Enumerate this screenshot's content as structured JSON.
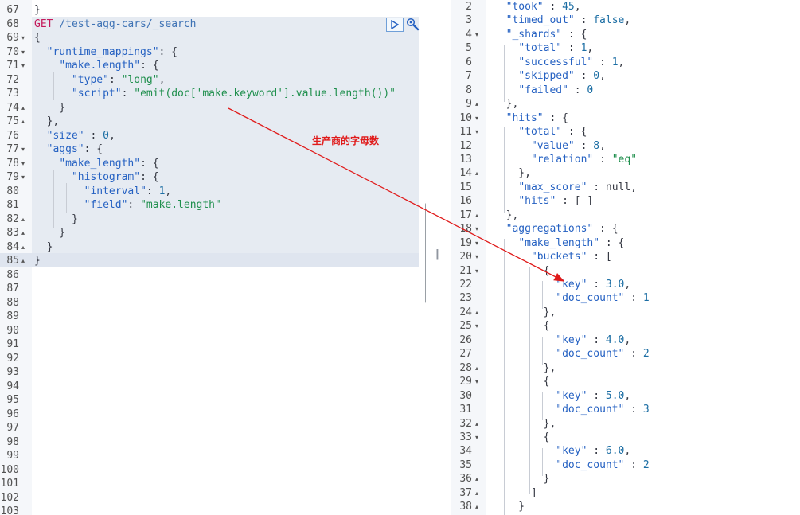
{
  "request_editor": {
    "lines": [
      {
        "n": "67",
        "fold": "",
        "parts": [
          [
            "p",
            "}"
          ]
        ]
      },
      {
        "n": "68",
        "fold": "",
        "parts": [
          [
            "m",
            "GET"
          ],
          [
            "p",
            " "
          ],
          [
            "u",
            "/test-agg-cars/_search"
          ]
        ]
      },
      {
        "n": "69",
        "fold": "▾",
        "parts": [
          [
            "p",
            "{"
          ]
        ]
      },
      {
        "n": "70",
        "fold": "▾",
        "parts": [
          [
            "p",
            "  "
          ],
          [
            "k",
            "\"runtime_mappings\""
          ],
          [
            "p",
            ": {"
          ]
        ]
      },
      {
        "n": "71",
        "fold": "▾",
        "parts": [
          [
            "p",
            "    "
          ],
          [
            "k",
            "\"make.length\""
          ],
          [
            "p",
            ": {"
          ]
        ]
      },
      {
        "n": "72",
        "fold": "",
        "parts": [
          [
            "p",
            "      "
          ],
          [
            "k",
            "\"type\""
          ],
          [
            "p",
            ": "
          ],
          [
            "s",
            "\"long\""
          ],
          [
            "p",
            ","
          ]
        ]
      },
      {
        "n": "73",
        "fold": "",
        "parts": [
          [
            "p",
            "      "
          ],
          [
            "k",
            "\"script\""
          ],
          [
            "p",
            ": "
          ],
          [
            "s",
            "\"emit(doc['make.keyword'].value.length())\""
          ]
        ]
      },
      {
        "n": "74",
        "fold": "▴",
        "parts": [
          [
            "p",
            "    }"
          ]
        ]
      },
      {
        "n": "75",
        "fold": "▴",
        "parts": [
          [
            "p",
            "  },"
          ]
        ]
      },
      {
        "n": "76",
        "fold": "",
        "parts": [
          [
            "p",
            "  "
          ],
          [
            "k",
            "\"size\""
          ],
          [
            "p",
            " : "
          ],
          [
            "n",
            "0"
          ],
          [
            "p",
            ","
          ]
        ]
      },
      {
        "n": "77",
        "fold": "▾",
        "parts": [
          [
            "p",
            "  "
          ],
          [
            "k",
            "\"aggs\""
          ],
          [
            "p",
            ": {"
          ]
        ]
      },
      {
        "n": "78",
        "fold": "▾",
        "parts": [
          [
            "p",
            "    "
          ],
          [
            "k",
            "\"make_length\""
          ],
          [
            "p",
            ": {"
          ]
        ]
      },
      {
        "n": "79",
        "fold": "▾",
        "parts": [
          [
            "p",
            "      "
          ],
          [
            "k",
            "\"histogram\""
          ],
          [
            "p",
            ": {"
          ]
        ]
      },
      {
        "n": "80",
        "fold": "",
        "parts": [
          [
            "p",
            "        "
          ],
          [
            "k",
            "\"interval\""
          ],
          [
            "p",
            ": "
          ],
          [
            "n",
            "1"
          ],
          [
            "p",
            ","
          ]
        ]
      },
      {
        "n": "81",
        "fold": "",
        "parts": [
          [
            "p",
            "        "
          ],
          [
            "k",
            "\"field\""
          ],
          [
            "p",
            ": "
          ],
          [
            "s",
            "\"make.length\""
          ]
        ]
      },
      {
        "n": "82",
        "fold": "▴",
        "parts": [
          [
            "p",
            "      }"
          ]
        ]
      },
      {
        "n": "83",
        "fold": "▴",
        "parts": [
          [
            "p",
            "    }"
          ]
        ]
      },
      {
        "n": "84",
        "fold": "▴",
        "parts": [
          [
            "p",
            "  }"
          ]
        ]
      },
      {
        "n": "85",
        "fold": "▴",
        "parts": [
          [
            "p",
            "}"
          ]
        ]
      },
      {
        "n": "86",
        "fold": "",
        "parts": []
      },
      {
        "n": "87",
        "fold": "",
        "parts": []
      },
      {
        "n": "88",
        "fold": "",
        "parts": []
      },
      {
        "n": "89",
        "fold": "",
        "parts": []
      },
      {
        "n": "90",
        "fold": "",
        "parts": []
      },
      {
        "n": "91",
        "fold": "",
        "parts": []
      },
      {
        "n": "92",
        "fold": "",
        "parts": []
      },
      {
        "n": "93",
        "fold": "",
        "parts": []
      },
      {
        "n": "94",
        "fold": "",
        "parts": []
      },
      {
        "n": "95",
        "fold": "",
        "parts": []
      },
      {
        "n": "96",
        "fold": "",
        "parts": []
      },
      {
        "n": "97",
        "fold": "",
        "parts": []
      },
      {
        "n": "98",
        "fold": "",
        "parts": []
      },
      {
        "n": "99",
        "fold": "",
        "parts": []
      },
      {
        "n": "100",
        "fold": "",
        "parts": []
      },
      {
        "n": "101",
        "fold": "",
        "parts": []
      },
      {
        "n": "102",
        "fold": "",
        "parts": []
      },
      {
        "n": "103",
        "fold": "",
        "parts": []
      }
    ]
  },
  "response_viewer": {
    "lines": [
      {
        "n": "2",
        "fold": "",
        "parts": [
          [
            "p",
            "  "
          ],
          [
            "k",
            "\"took\""
          ],
          [
            "p",
            " : "
          ],
          [
            "n",
            "45"
          ],
          [
            "p",
            ","
          ]
        ]
      },
      {
        "n": "3",
        "fold": "",
        "parts": [
          [
            "p",
            "  "
          ],
          [
            "k",
            "\"timed_out\""
          ],
          [
            "p",
            " : "
          ],
          [
            "n",
            "false"
          ],
          [
            "p",
            ","
          ]
        ]
      },
      {
        "n": "4",
        "fold": "▾",
        "parts": [
          [
            "p",
            "  "
          ],
          [
            "k",
            "\"_shards\""
          ],
          [
            "p",
            " : {"
          ]
        ]
      },
      {
        "n": "5",
        "fold": "",
        "parts": [
          [
            "p",
            "    "
          ],
          [
            "k",
            "\"total\""
          ],
          [
            "p",
            " : "
          ],
          [
            "n",
            "1"
          ],
          [
            "p",
            ","
          ]
        ]
      },
      {
        "n": "6",
        "fold": "",
        "parts": [
          [
            "p",
            "    "
          ],
          [
            "k",
            "\"successful\""
          ],
          [
            "p",
            " : "
          ],
          [
            "n",
            "1"
          ],
          [
            "p",
            ","
          ]
        ]
      },
      {
        "n": "7",
        "fold": "",
        "parts": [
          [
            "p",
            "    "
          ],
          [
            "k",
            "\"skipped\""
          ],
          [
            "p",
            " : "
          ],
          [
            "n",
            "0"
          ],
          [
            "p",
            ","
          ]
        ]
      },
      {
        "n": "8",
        "fold": "",
        "parts": [
          [
            "p",
            "    "
          ],
          [
            "k",
            "\"failed\""
          ],
          [
            "p",
            " : "
          ],
          [
            "n",
            "0"
          ]
        ]
      },
      {
        "n": "9",
        "fold": "▴",
        "parts": [
          [
            "p",
            "  },"
          ]
        ]
      },
      {
        "n": "10",
        "fold": "▾",
        "parts": [
          [
            "p",
            "  "
          ],
          [
            "k",
            "\"hits\""
          ],
          [
            "p",
            " : {"
          ]
        ]
      },
      {
        "n": "11",
        "fold": "▾",
        "parts": [
          [
            "p",
            "    "
          ],
          [
            "k",
            "\"total\""
          ],
          [
            "p",
            " : {"
          ]
        ]
      },
      {
        "n": "12",
        "fold": "",
        "parts": [
          [
            "p",
            "      "
          ],
          [
            "k",
            "\"value\""
          ],
          [
            "p",
            " : "
          ],
          [
            "n",
            "8"
          ],
          [
            "p",
            ","
          ]
        ]
      },
      {
        "n": "13",
        "fold": "",
        "parts": [
          [
            "p",
            "      "
          ],
          [
            "k",
            "\"relation\""
          ],
          [
            "p",
            " : "
          ],
          [
            "s",
            "\"eq\""
          ]
        ]
      },
      {
        "n": "14",
        "fold": "▴",
        "parts": [
          [
            "p",
            "    },"
          ]
        ]
      },
      {
        "n": "15",
        "fold": "",
        "parts": [
          [
            "p",
            "    "
          ],
          [
            "k",
            "\"max_score\""
          ],
          [
            "p",
            " : "
          ],
          [
            "p",
            "null"
          ],
          [
            "p",
            ","
          ]
        ]
      },
      {
        "n": "16",
        "fold": "",
        "parts": [
          [
            "p",
            "    "
          ],
          [
            "k",
            "\"hits\""
          ],
          [
            "p",
            " : [ ]"
          ]
        ]
      },
      {
        "n": "17",
        "fold": "▴",
        "parts": [
          [
            "p",
            "  },"
          ]
        ]
      },
      {
        "n": "18",
        "fold": "▾",
        "parts": [
          [
            "p",
            "  "
          ],
          [
            "k",
            "\"aggregations\""
          ],
          [
            "p",
            " : {"
          ]
        ]
      },
      {
        "n": "19",
        "fold": "▾",
        "parts": [
          [
            "p",
            "    "
          ],
          [
            "k",
            "\"make_length\""
          ],
          [
            "p",
            " : {"
          ]
        ]
      },
      {
        "n": "20",
        "fold": "▾",
        "parts": [
          [
            "p",
            "      "
          ],
          [
            "k",
            "\"buckets\""
          ],
          [
            "p",
            " : ["
          ]
        ]
      },
      {
        "n": "21",
        "fold": "▾",
        "parts": [
          [
            "p",
            "        {"
          ]
        ]
      },
      {
        "n": "22",
        "fold": "",
        "parts": [
          [
            "p",
            "          "
          ],
          [
            "k",
            "\"key\""
          ],
          [
            "p",
            " : "
          ],
          [
            "n",
            "3.0"
          ],
          [
            "p",
            ","
          ]
        ]
      },
      {
        "n": "23",
        "fold": "",
        "parts": [
          [
            "p",
            "          "
          ],
          [
            "k",
            "\"doc_count\""
          ],
          [
            "p",
            " : "
          ],
          [
            "n",
            "1"
          ]
        ]
      },
      {
        "n": "24",
        "fold": "▴",
        "parts": [
          [
            "p",
            "        },"
          ]
        ]
      },
      {
        "n": "25",
        "fold": "▾",
        "parts": [
          [
            "p",
            "        {"
          ]
        ]
      },
      {
        "n": "26",
        "fold": "",
        "parts": [
          [
            "p",
            "          "
          ],
          [
            "k",
            "\"key\""
          ],
          [
            "p",
            " : "
          ],
          [
            "n",
            "4.0"
          ],
          [
            "p",
            ","
          ]
        ]
      },
      {
        "n": "27",
        "fold": "",
        "parts": [
          [
            "p",
            "          "
          ],
          [
            "k",
            "\"doc_count\""
          ],
          [
            "p",
            " : "
          ],
          [
            "n",
            "2"
          ]
        ]
      },
      {
        "n": "28",
        "fold": "▴",
        "parts": [
          [
            "p",
            "        },"
          ]
        ]
      },
      {
        "n": "29",
        "fold": "▾",
        "parts": [
          [
            "p",
            "        {"
          ]
        ]
      },
      {
        "n": "30",
        "fold": "",
        "parts": [
          [
            "p",
            "          "
          ],
          [
            "k",
            "\"key\""
          ],
          [
            "p",
            " : "
          ],
          [
            "n",
            "5.0"
          ],
          [
            "p",
            ","
          ]
        ]
      },
      {
        "n": "31",
        "fold": "",
        "parts": [
          [
            "p",
            "          "
          ],
          [
            "k",
            "\"doc_count\""
          ],
          [
            "p",
            " : "
          ],
          [
            "n",
            "3"
          ]
        ]
      },
      {
        "n": "32",
        "fold": "▴",
        "parts": [
          [
            "p",
            "        },"
          ]
        ]
      },
      {
        "n": "33",
        "fold": "▾",
        "parts": [
          [
            "p",
            "        {"
          ]
        ]
      },
      {
        "n": "34",
        "fold": "",
        "parts": [
          [
            "p",
            "          "
          ],
          [
            "k",
            "\"key\""
          ],
          [
            "p",
            " : "
          ],
          [
            "n",
            "6.0"
          ],
          [
            "p",
            ","
          ]
        ]
      },
      {
        "n": "35",
        "fold": "",
        "parts": [
          [
            "p",
            "          "
          ],
          [
            "k",
            "\"doc_count\""
          ],
          [
            "p",
            " : "
          ],
          [
            "n",
            "2"
          ]
        ]
      },
      {
        "n": "36",
        "fold": "▴",
        "parts": [
          [
            "p",
            "        }"
          ]
        ]
      },
      {
        "n": "37",
        "fold": "▴",
        "parts": [
          [
            "p",
            "      ]"
          ]
        ]
      },
      {
        "n": "38",
        "fold": "▴",
        "parts": [
          [
            "p",
            "    }"
          ]
        ]
      }
    ]
  },
  "annotation": {
    "text": "生产商的字母数",
    "color": "#e01b1b"
  },
  "colors": {
    "key": "#2561c2",
    "string": "#1f8f4d",
    "number": "#1c6ea4",
    "method": "#c41a5b",
    "accent": "#6f9fd8"
  },
  "icons": {
    "run": "play-icon",
    "settings": "wrench-icon",
    "resize": "drag-handle-icon"
  }
}
